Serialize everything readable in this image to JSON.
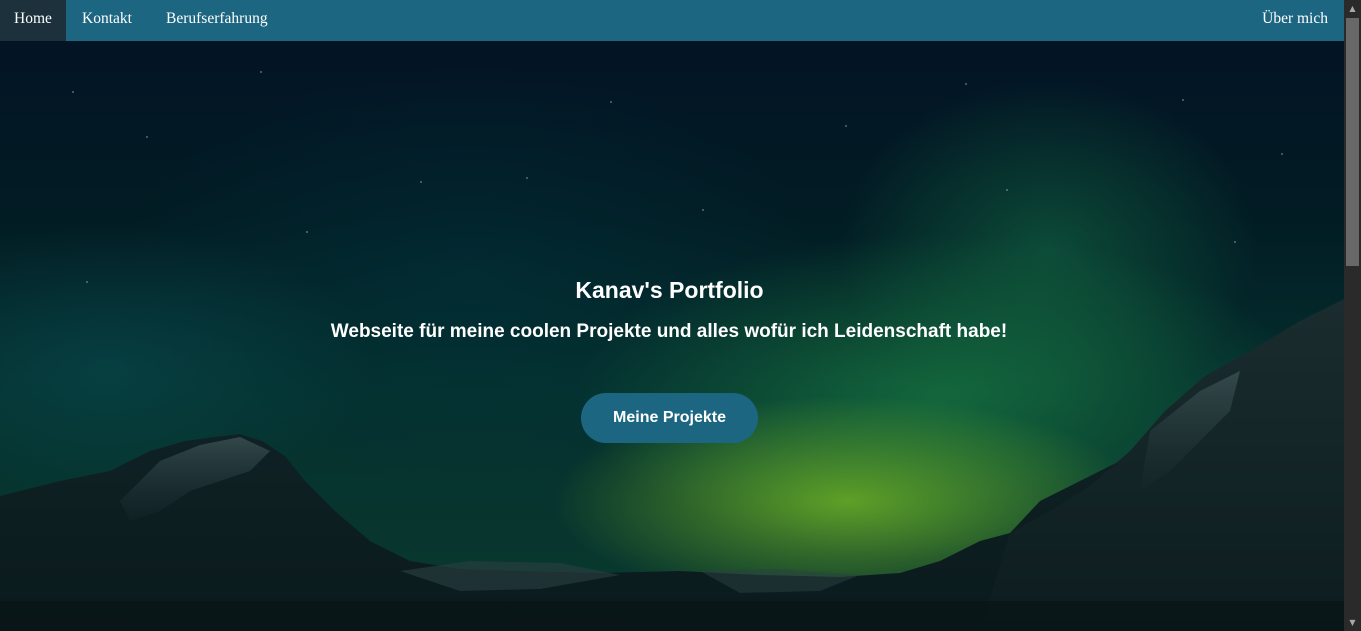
{
  "nav": {
    "home": "Home",
    "kontakt": "Kontakt",
    "berufserfahrung": "Berufserfahrung",
    "ueber_mich": "Über mich"
  },
  "hero": {
    "title": "Kanav's Portfolio",
    "subtitle": "Webseite für meine coolen Projekte und alles wofür ich Leidenschaft habe!",
    "button_label": "Meine Projekte"
  },
  "colors": {
    "navbar": "#1d6682",
    "nav_active": "#1c313c",
    "button": "#1d6682",
    "text": "#ffffff"
  },
  "scrollbar": {
    "up_icon": "triangle-up",
    "down_icon": "triangle-down"
  }
}
